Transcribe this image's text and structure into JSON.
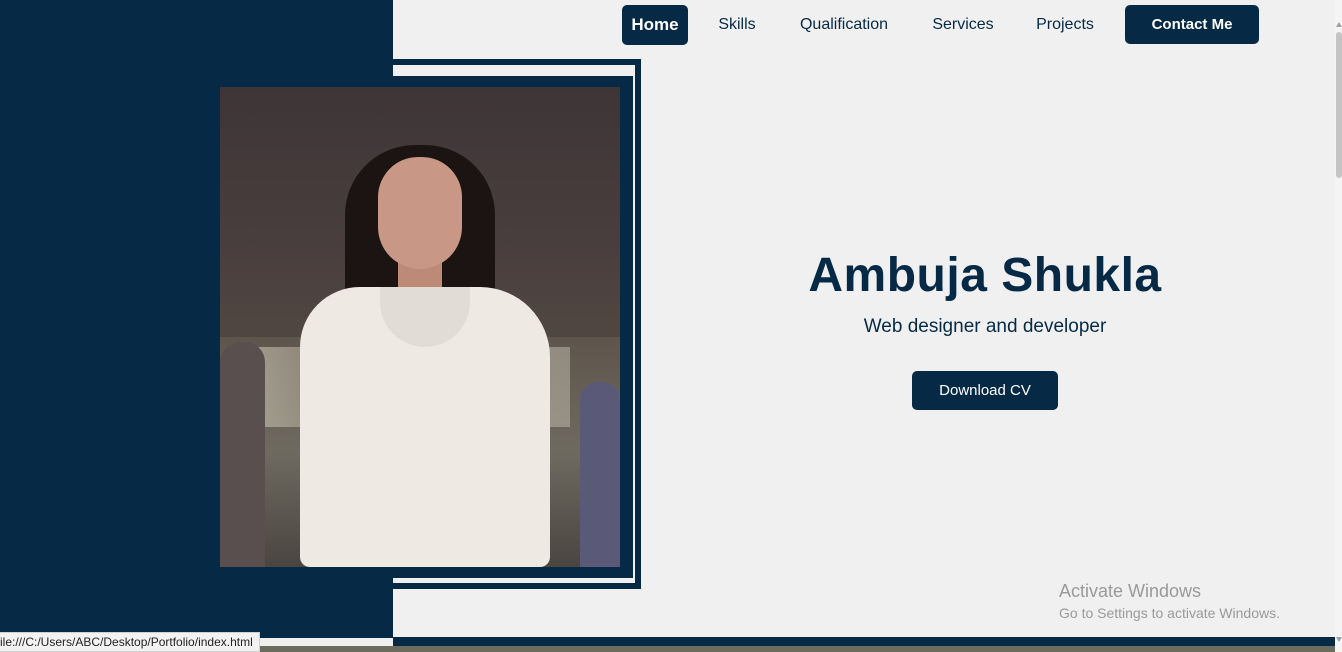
{
  "nav": {
    "items": [
      {
        "label": "Home",
        "active": true
      },
      {
        "label": "Skills",
        "active": false
      },
      {
        "label": "Qualification",
        "active": false
      },
      {
        "label": "Services",
        "active": false
      },
      {
        "label": "Projects",
        "active": false
      }
    ],
    "contact_label": "Contact Me"
  },
  "hero": {
    "name": "Ambuja Shukla",
    "subtitle": "Web designer and developer",
    "cv_button": "Download CV"
  },
  "watermark": {
    "title": "Activate Windows",
    "subtitle": "Go to Settings to activate Windows."
  },
  "status_bar": {
    "url": "ile:///C:/Users/ABC/Desktop/Portfolio/index.html"
  },
  "colors": {
    "primary": "#062a45",
    "background": "#f0f0f0"
  }
}
